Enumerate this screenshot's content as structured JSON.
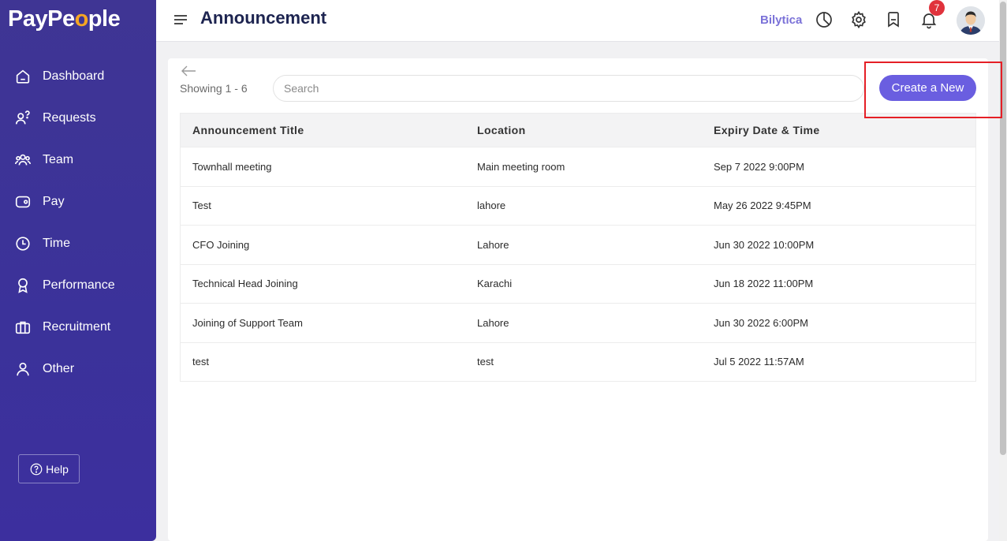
{
  "brand": {
    "name_part1": "PayPe",
    "name_o": "o",
    "name_part2": "ple"
  },
  "sidebar": {
    "items": [
      {
        "label": "Dashboard",
        "icon": "home-icon"
      },
      {
        "label": "Requests",
        "icon": "user-question-icon"
      },
      {
        "label": "Team",
        "icon": "team-icon"
      },
      {
        "label": "Pay",
        "icon": "wallet-icon"
      },
      {
        "label": "Time",
        "icon": "clock-icon"
      },
      {
        "label": "Performance",
        "icon": "award-icon"
      },
      {
        "label": "Recruitment",
        "icon": "briefcase-icon"
      },
      {
        "label": "Other",
        "icon": "user-icon"
      }
    ],
    "help_label": "Help"
  },
  "header": {
    "title": "Announcement",
    "company": "Bilytica",
    "notification_count": "7"
  },
  "main": {
    "showing": "Showing 1 - 6",
    "search_placeholder": "Search",
    "create_label": "Create a New",
    "columns": [
      "Announcement Title",
      "Location",
      "Expiry Date & Time"
    ],
    "rows": [
      [
        "Townhall meeting",
        "Main meeting room",
        "Sep 7 2022 9:00PM"
      ],
      [
        "Test",
        "lahore",
        "May 26 2022 9:45PM"
      ],
      [
        "CFO Joining",
        "Lahore",
        "Jun 30 2022 10:00PM"
      ],
      [
        "Technical Head Joining",
        "Karachi",
        "Jun 18 2022 11:00PM"
      ],
      [
        "Joining of Support Team",
        "Lahore",
        "Jun 30 2022 6:00PM"
      ],
      [
        "test",
        "test",
        "Jul 5 2022 11:57AM"
      ]
    ]
  },
  "colors": {
    "sidebar": "#3f3594",
    "accent": "#6a5ee0",
    "title": "#1d2450",
    "badge": "#e0323c",
    "highlight": "#e51f26"
  }
}
